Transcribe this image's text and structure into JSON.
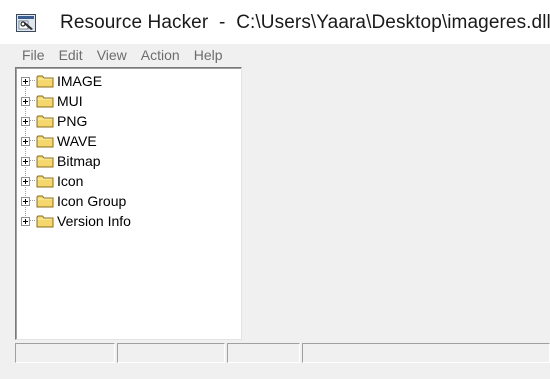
{
  "window": {
    "title": "Resource Hacker  -  C:\\Users\\Yaara\\Desktop\\imageres.dll",
    "app_icon": "resource-hacker-icon"
  },
  "menu": {
    "items": [
      {
        "label": "File"
      },
      {
        "label": "Edit"
      },
      {
        "label": "View"
      },
      {
        "label": "Action"
      },
      {
        "label": "Help"
      }
    ]
  },
  "tree": {
    "items": [
      {
        "label": "IMAGE",
        "icon": "folder-icon",
        "expanded": false
      },
      {
        "label": "MUI",
        "icon": "folder-icon",
        "expanded": false
      },
      {
        "label": "PNG",
        "icon": "folder-icon",
        "expanded": false
      },
      {
        "label": "WAVE",
        "icon": "folder-icon",
        "expanded": false
      },
      {
        "label": "Bitmap",
        "icon": "folder-icon",
        "expanded": false
      },
      {
        "label": "Icon",
        "icon": "folder-icon",
        "expanded": false
      },
      {
        "label": "Icon Group",
        "icon": "folder-icon",
        "expanded": false
      },
      {
        "label": "Version Info",
        "icon": "folder-icon",
        "expanded": false
      }
    ]
  },
  "statusbar": {
    "panels": [
      {
        "text": ""
      },
      {
        "text": ""
      },
      {
        "text": ""
      },
      {
        "text": ""
      }
    ]
  },
  "colors": {
    "folder_fill": "#f5d76e",
    "folder_outline": "#8a6d1d",
    "window_bg": "#f0f0f0",
    "tree_bg": "#ffffff"
  }
}
